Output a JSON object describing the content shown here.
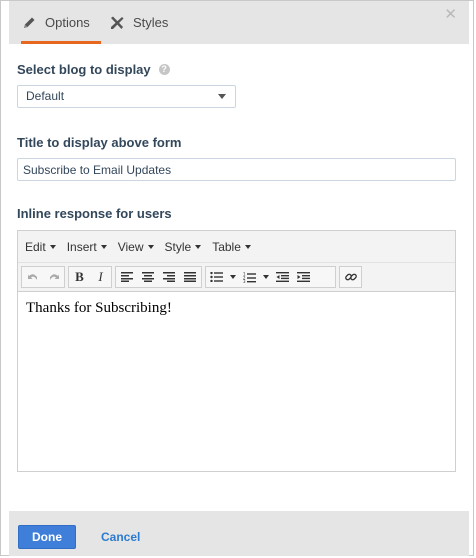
{
  "tabs": [
    {
      "label": "Options",
      "icon": "pencil-icon"
    },
    {
      "label": "Styles",
      "icon": "tools-icon"
    }
  ],
  "accent_color": "#e8671e",
  "close_icon": "close-icon",
  "fields": {
    "blog": {
      "label": "Select blog to display",
      "value": "Default"
    },
    "title": {
      "label": "Title to display above form",
      "value": "Subscribe to Email Updates"
    },
    "response": {
      "label": "Inline response for users"
    }
  },
  "editor": {
    "menus": [
      "Edit",
      "Insert",
      "View",
      "Style",
      "Table"
    ],
    "toolbar_icons": [
      "undo-icon",
      "redo-icon",
      "bold-icon",
      "italic-icon",
      "align-left-icon",
      "align-center-icon",
      "align-right-icon",
      "align-justify-icon",
      "bullet-list-icon",
      "numbered-list-icon",
      "outdent-icon",
      "indent-icon",
      "link-icon"
    ],
    "bold_glyph": "B",
    "italic_glyph": "I",
    "content": "Thanks for Subscribing!"
  },
  "footer": {
    "done_label": "Done",
    "cancel_label": "Cancel",
    "primary_color": "#3f7fd9"
  }
}
